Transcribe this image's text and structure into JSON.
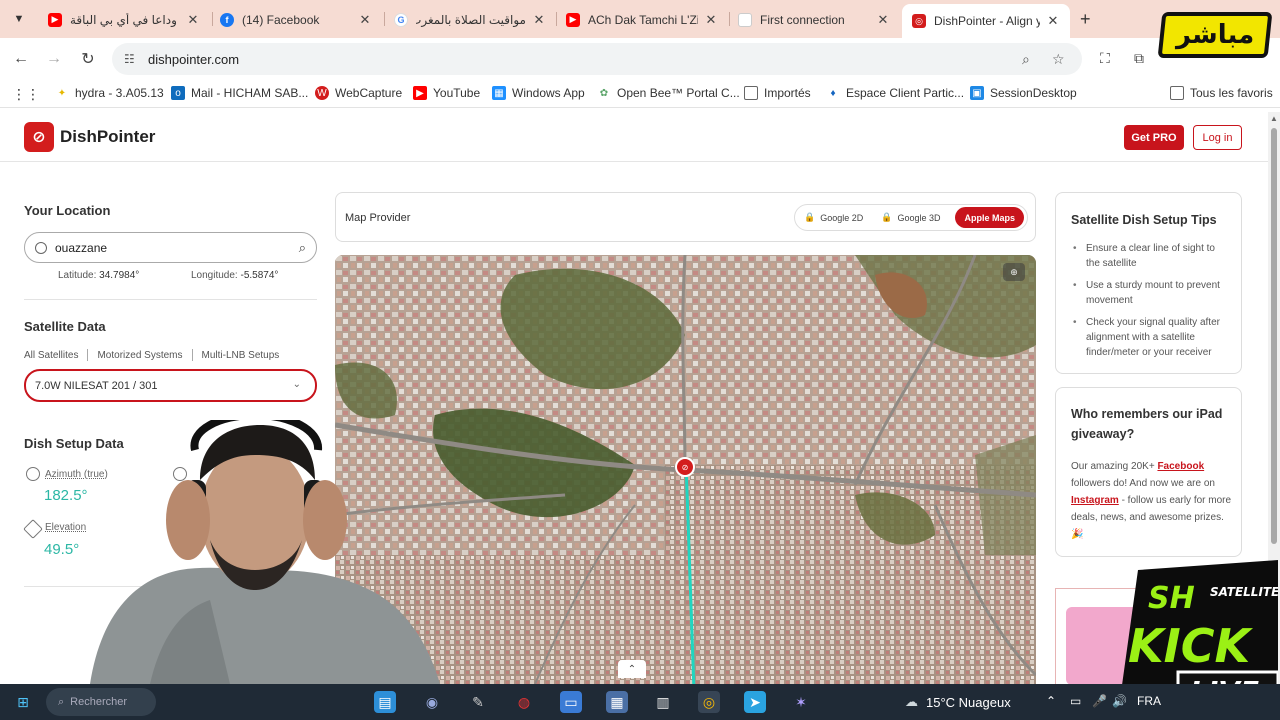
{
  "browser": {
    "tabs": [
      {
        "title": "وداعا في أي بي الباقة",
        "favicon": "youtube-icon",
        "color": "#ff0000"
      },
      {
        "title": "(14) Facebook",
        "favicon": "facebook-icon",
        "color": "#1877f2"
      },
      {
        "title": "مواقيت الصلاة بالمغرب",
        "favicon": "google-icon",
        "color": "#4285f4"
      },
      {
        "title": "ACh Dak Tamchi L'Zin",
        "favicon": "youtube-icon",
        "color": "#ff0000"
      },
      {
        "title": "First connection",
        "favicon": "page-icon",
        "color": "#dddddd"
      },
      {
        "title": "DishPointer - Align yo",
        "favicon": "dishpointer-icon",
        "color": "#d31d1d"
      }
    ],
    "url": "dishpointer.com",
    "bookmarks": [
      {
        "label": "hydra - 3.A05.13",
        "icon": "hydra-icon",
        "color": "#e6b800"
      },
      {
        "label": "Mail - HICHAM SAB...",
        "icon": "outlook-icon",
        "color": "#0f6cbd"
      },
      {
        "label": "WebCapture",
        "icon": "webcapture-icon",
        "color": "#d31d1d"
      },
      {
        "label": "YouTube",
        "icon": "youtube-icon",
        "color": "#ff0000"
      },
      {
        "label": "Windows App",
        "icon": "windows-icon",
        "color": "#1e90ff"
      },
      {
        "label": "Open Bee™ Portal C...",
        "icon": "openbee-icon",
        "color": "#5aa469"
      },
      {
        "label": "Importés",
        "icon": "folder-icon",
        "color": "#666666"
      },
      {
        "label": "Espace Client Partic...",
        "icon": "espace-icon",
        "color": "#1565c0"
      },
      {
        "label": "SessionDesktop",
        "icon": "session-icon",
        "color": "#1e88e5"
      }
    ],
    "all_bookmarks": "Tous les favoris"
  },
  "overlay": {
    "live_badge": "مباشر",
    "kick_brand": "SH SATELLITE",
    "kick_word": "KICK",
    "kick_live": "LIVE"
  },
  "site": {
    "brand": "DishPointer",
    "get_pro": "Get PRO",
    "login": "Log in",
    "accent": "#c8141c",
    "teal": "#2cb7a5"
  },
  "location": {
    "heading": "Your Location",
    "query": "ouazzane",
    "latitude_label": "Latitude:",
    "latitude": "34.7984°",
    "longitude_label": "Longitude:",
    "longitude": "-5.5874°"
  },
  "satellite": {
    "heading": "Satellite Data",
    "tabs": [
      "All Satellites",
      "Motorized Systems",
      "Multi-LNB Setups"
    ],
    "selected": "7.0W NILESAT 201 / 301"
  },
  "dish": {
    "heading": "Dish Setup Data",
    "azimuth_label": "Azimuth (true)",
    "azimuth": "182.5°",
    "elevation_label": "Elevation",
    "elevation": "49.5°"
  },
  "map": {
    "provider_label": "Map Provider",
    "options": [
      "Google 2D",
      "Google 3D",
      "Apple Maps"
    ],
    "active": "Apple Maps"
  },
  "tips": {
    "title": "Satellite Dish Setup Tips",
    "items": [
      "Ensure a clear line of sight to the satellite",
      "Use a sturdy mount to prevent movement",
      "Check your signal quality after alignment with a satellite finder/meter or your receiver"
    ]
  },
  "giveaway": {
    "title": "Who remembers our iPad giveaway?",
    "text1": "Our amazing 20K+",
    "facebook": "Facebook",
    "text2": "followers do! And now we are on",
    "instagram": "Instagram",
    "text3": "- follow us early for more deals, news, and awesome prizes. 🎉"
  },
  "taskbar": {
    "search_placeholder": "Rechercher",
    "weather": "15°C Nuageux",
    "lang": "FRA"
  }
}
